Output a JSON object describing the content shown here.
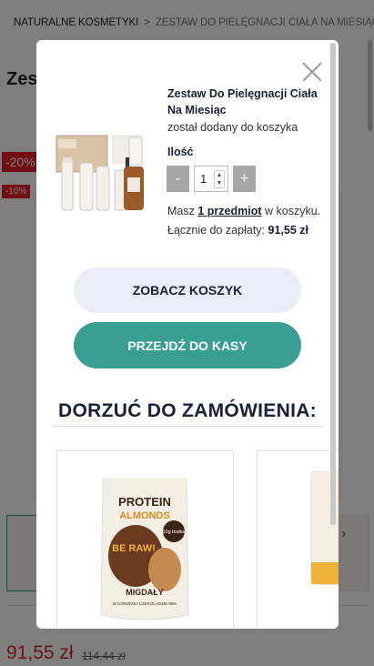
{
  "breadcrumb": {
    "parent": "NATURALNE KOSMETYKI",
    "separator": ">",
    "current": "ZESTAW DO PIELĘGNACJI CIAŁA NA MIESIĄC"
  },
  "page": {
    "title_partial": "Zest",
    "discount_badge": "-20%",
    "discount_badge_small": "-10%",
    "price_current": "91,55 zł",
    "price_old": "114,44 zł"
  },
  "modal": {
    "product_name": "Zestaw Do Pielęgnacji Ciała Na Miesiąc",
    "added_text": "został dodany do koszyka",
    "quantity_label": "Ilość",
    "quantity_value": "1",
    "minus_label": "-",
    "plus_label": "+",
    "cart_count_prefix": "Masz",
    "cart_count_link": "1 przedmiot",
    "cart_count_suffix": "w koszyku.",
    "total_label": "Łącznie do zapłaty:",
    "total_value": "91,55 zł",
    "view_cart_button": "ZOBACZ KOSZYK",
    "checkout_button": "PRZEJDŹ DO KASY",
    "recommendations_heading": "DORZUĆ DO ZAMÓWIENIA:",
    "recommendation_product_image_text": {
      "line1": "PROTEIN",
      "line2": "ALMONDS",
      "badge": "10g białka",
      "brand": "BE RAW!",
      "flavor": "MIGDAŁY",
      "subtitle": "W GORZKIEJ CZEKOLADZIE 86%"
    }
  },
  "colors": {
    "accent_teal": "#3a9f93",
    "navy_text": "#1a1f3c",
    "sale_red": "#e41e2b",
    "view_cart_bg": "#eaedf7"
  }
}
